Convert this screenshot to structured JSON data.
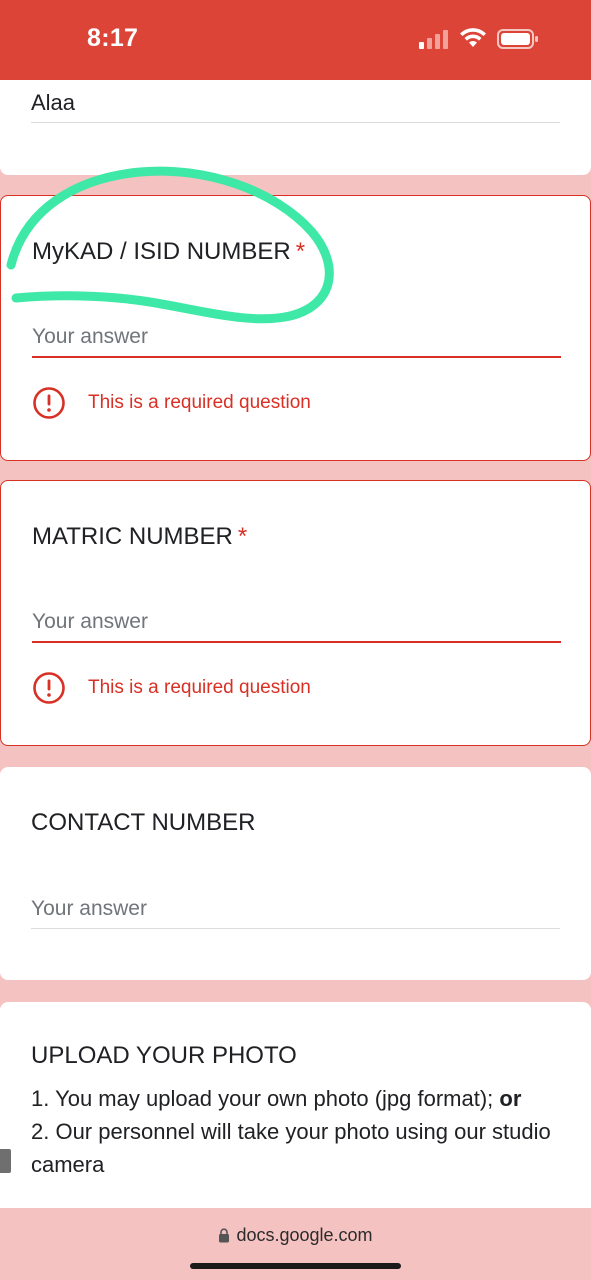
{
  "status_bar": {
    "time": "8:17"
  },
  "form": {
    "name_value": "Alaa",
    "questions": [
      {
        "title": "MyKAD / ISID NUMBER",
        "required_mark": "*",
        "placeholder": "Your answer",
        "error": "This is a required question"
      },
      {
        "title": "MATRIC NUMBER",
        "required_mark": "*",
        "placeholder": "Your answer",
        "error": "This is a required question"
      },
      {
        "title": "CONTACT NUMBER",
        "placeholder": "Your answer"
      }
    ],
    "upload": {
      "title": "UPLOAD YOUR PHOTO",
      "line1": "1. You may upload your own photo (jpg format); ",
      "line1_bold": "or",
      "line2": "2. Our personnel will take your photo using our studio camera"
    }
  },
  "browser": {
    "url": "docs.google.com"
  },
  "colors": {
    "theme_red": "#db4437",
    "error_red": "#d93025",
    "page_pink": "#f4c2c0",
    "scribble_green": "#3ee8a6"
  },
  "icons": [
    "cellular-signal-icon",
    "wifi-icon",
    "battery-icon",
    "error-icon",
    "lock-icon"
  ]
}
